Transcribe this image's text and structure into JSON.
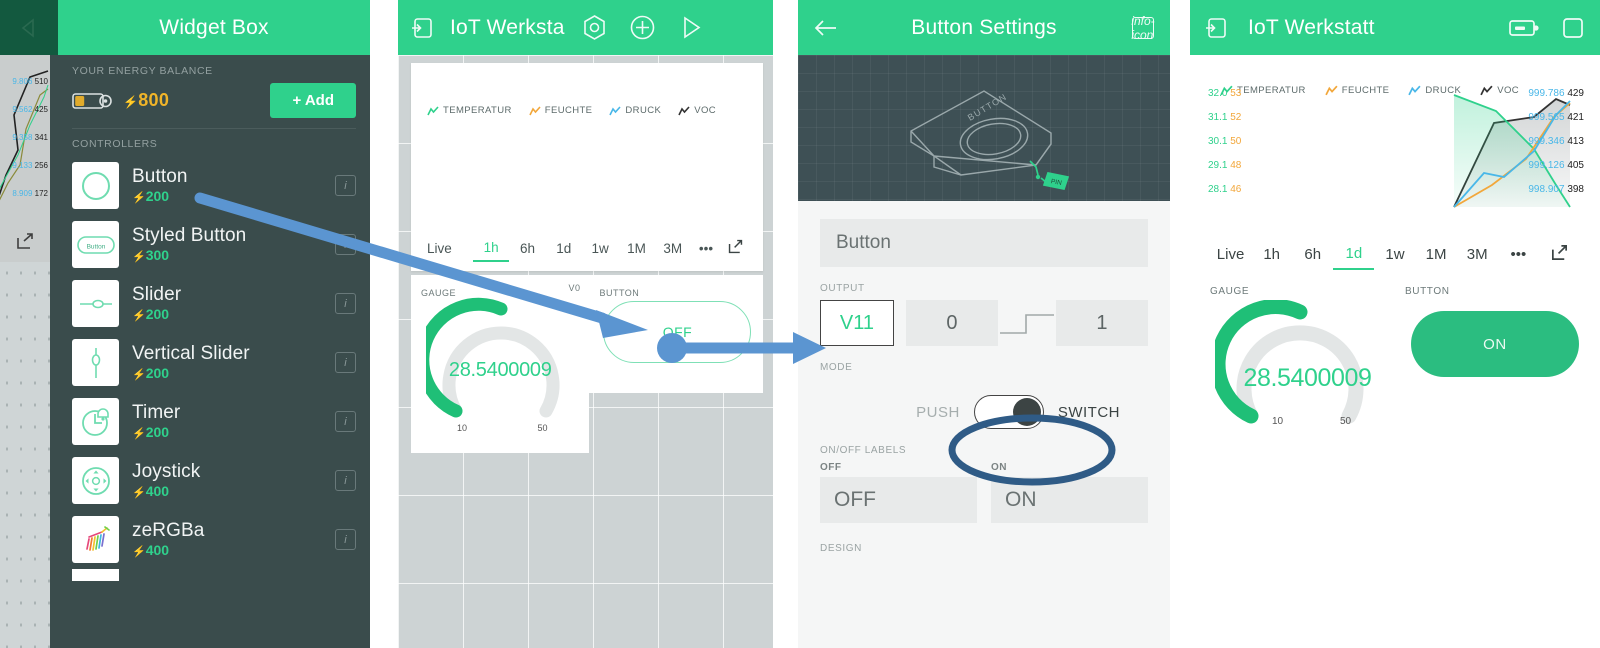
{
  "accent_green": "#2fd18c",
  "dark_panel": "#3a4c4c",
  "annotation_blue": "#5b95d1",
  "annotation_navy": "#2f5b86",
  "sliver": {
    "name": "partial-previous-screen",
    "chart_rows": [
      {
        "blue": "9.806",
        "dark": "510"
      },
      {
        "blue": "9.562",
        "dark": "425"
      },
      {
        "blue": "9.358",
        "dark": "341"
      },
      {
        "blue": "9.133",
        "dark": "256"
      },
      {
        "blue": "8.909",
        "dark": "172"
      }
    ]
  },
  "widget_box": {
    "title": "Widget Box",
    "back_icon": "back-triangle-icon",
    "energy": {
      "label": "YOUR ENERGY BALANCE",
      "battery_icon": "battery-icon",
      "bolt": "⚡",
      "value": "800",
      "add_label": "+ Add"
    },
    "section_label": "CONTROLLERS",
    "items": [
      {
        "name": "Button",
        "cost": "200",
        "icon": "circle-button-icon",
        "info": "i"
      },
      {
        "name": "Styled Button",
        "cost": "300",
        "icon": "styled-button-icon",
        "info": "i"
      },
      {
        "name": "Slider",
        "cost": "200",
        "icon": "slider-icon",
        "info": "i"
      },
      {
        "name": "Vertical Slider",
        "cost": "200",
        "icon": "vertical-slider-icon",
        "info": "i"
      },
      {
        "name": "Timer",
        "cost": "200",
        "icon": "timer-clock-icon",
        "info": "i"
      },
      {
        "name": "Joystick",
        "cost": "400",
        "icon": "joystick-icon",
        "info": "i"
      },
      {
        "name": "zeRGBa",
        "cost": "400",
        "icon": "zergba-zebra-icon",
        "info": "i"
      }
    ]
  },
  "editor": {
    "title": "IoT Werksta",
    "icons": [
      "project-exit-icon",
      "hexagon-settings-icon",
      "plus-add-icon",
      "play-run-icon"
    ],
    "legend": [
      {
        "label": "TEMPERATUR",
        "color": "#2fd18c"
      },
      {
        "label": "FEUCHTE",
        "color": "#f2a73b"
      },
      {
        "label": "DRUCK",
        "color": "#49b7e8"
      },
      {
        "label": "VOC",
        "color": "#333333"
      }
    ],
    "time_tabs": [
      "Live",
      "1h",
      "6h",
      "1d",
      "1w",
      "1M",
      "3M"
    ],
    "active_tab": "1h",
    "more_icon": "ellipsis-icon",
    "export_icon": "export-share-icon",
    "gauge": {
      "label": "GAUGE",
      "corner_label": "V0",
      "value": "28.5400009",
      "min": "10",
      "max": "50"
    },
    "button_widget": {
      "label": "BUTTON",
      "state": "OFF"
    }
  },
  "button_settings": {
    "title": "Button Settings",
    "back_icon": "arrow-left-icon",
    "info_icon": "info-icon",
    "hero_icon": "button-device-3d-icon",
    "hero_device_label": "BUTTON",
    "hero_pin_label": "PIN",
    "name_value": "Button",
    "output": {
      "section": "OUTPUT",
      "pin": "V11",
      "low": "0",
      "high": "1",
      "step_icon": "step-waveform-icon"
    },
    "mode": {
      "section": "MODE",
      "push_label": "PUSH",
      "switch_label": "SWITCH",
      "toggle_state": "SWITCH"
    },
    "onoff": {
      "section": "ON/OFF LABELS",
      "off_caption": "OFF",
      "off_value": "OFF",
      "on_caption": "ON",
      "on_value": "ON"
    },
    "design_section": "DESIGN"
  },
  "run_mode": {
    "title": "IoT Werkstatt",
    "icons": [
      "project-exit-icon",
      "battery-icon",
      "stop-square-icon"
    ],
    "legend": [
      {
        "label": "TEMPERATUR",
        "color": "#2fd18c"
      },
      {
        "label": "FEUCHTE",
        "color": "#f2a73b"
      },
      {
        "label": "DRUCK",
        "color": "#49b7e8"
      },
      {
        "label": "VOC",
        "color": "#333333"
      }
    ],
    "time_tabs": [
      "Live",
      "1h",
      "6h",
      "1d",
      "1w",
      "1M",
      "3M"
    ],
    "active_tab": "1d",
    "more_icon": "ellipsis-icon",
    "export_icon": "export-share-icon",
    "gauge": {
      "label": "GAUGE",
      "value": "28.5400009",
      "min": "10",
      "max": "50"
    },
    "button_widget": {
      "label": "BUTTON",
      "state": "ON"
    }
  },
  "chart_data": {
    "type": "line",
    "title": "",
    "series": [
      {
        "name": "TEMPERATUR",
        "color": "#2fd18c",
        "axis": "left-1",
        "ticks": [
          "32.0",
          "31.1",
          "30.1",
          "29.1",
          "28.1"
        ],
        "values": [
          32.0,
          31.6,
          29.4,
          28.6,
          28.1
        ]
      },
      {
        "name": "FEUCHTE",
        "color": "#f2a73b",
        "axis": "left-2",
        "ticks": [
          "53",
          "52",
          "50",
          "48",
          "46"
        ],
        "values": [
          46,
          46.5,
          48.8,
          51.5,
          53
        ]
      },
      {
        "name": "DRUCK",
        "color": "#49b7e8",
        "axis": "right-1",
        "ticks": [
          "999.786",
          "999.565",
          "999.346",
          "999.126",
          "998.907"
        ],
        "values": [
          998.907,
          999.1,
          999.12,
          999.4,
          999.786
        ]
      },
      {
        "name": "VOC",
        "color": "#333333",
        "axis": "right-2",
        "ticks": [
          "429",
          "421",
          "413",
          "405",
          "398"
        ],
        "values": [
          398,
          424,
          426,
          429,
          428
        ]
      }
    ],
    "xlabel": "",
    "ylabel": "",
    "grid": false,
    "legend_position": "top"
  }
}
